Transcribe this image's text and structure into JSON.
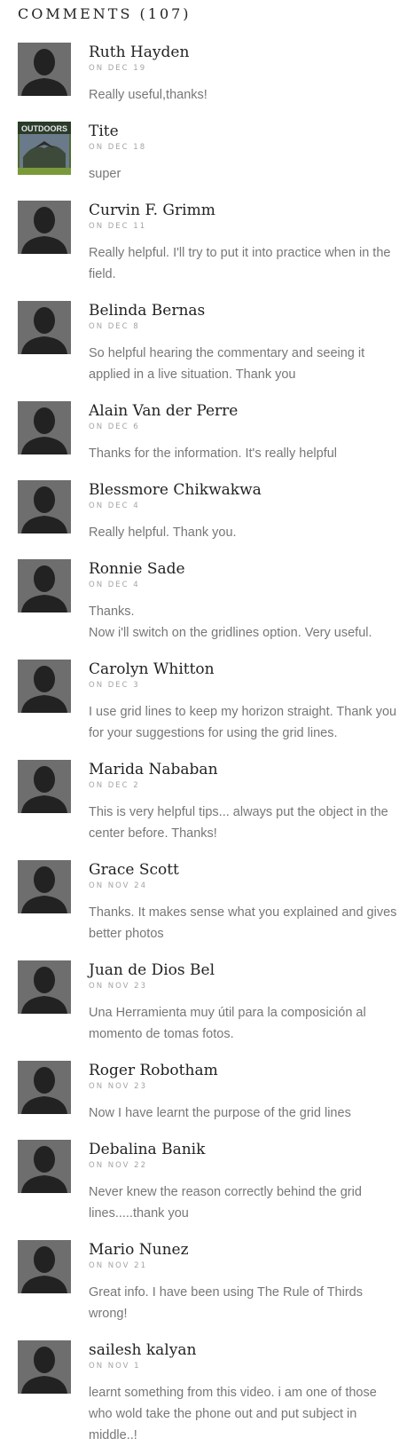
{
  "comments_heading": "COMMENTS (107)",
  "comments": [
    {
      "author": "Ruth Hayden",
      "date": "ON DEC 19",
      "text": "Really useful,thanks!",
      "avatar": "default-avatar"
    },
    {
      "author": "Tite",
      "date": "ON DEC 18",
      "text": "super",
      "avatar": "outdoors-avatar",
      "avatar_text": "OUTDOORS"
    },
    {
      "author": "Curvin F. Grimm",
      "date": "ON DEC 11",
      "text": "Really helpful. I'll try to put it into practice when in the field.",
      "avatar": "default-avatar"
    },
    {
      "author": "Belinda Bernas",
      "date": "ON DEC 8",
      "text": "So helpful hearing the commentary and seeing it applied in a live situation. Thank you",
      "avatar": "default-avatar"
    },
    {
      "author": "Alain Van der Perre",
      "date": "ON DEC 6",
      "text": "Thanks for the information. It's really helpful",
      "avatar": "default-avatar"
    },
    {
      "author": "Blessmore Chikwakwa",
      "date": "ON DEC 4",
      "text": "Really helpful. Thank you.",
      "avatar": "default-avatar"
    },
    {
      "author": "Ronnie Sade",
      "date": "ON DEC 4",
      "text": "Thanks.\nNow i'll switch on the gridlines option. Very useful.",
      "avatar": "default-avatar"
    },
    {
      "author": "Carolyn Whitton",
      "date": "ON DEC 3",
      "text": "I use grid lines to keep my horizon straight. Thank you for your suggestions for using the grid lines.",
      "avatar": "default-avatar"
    },
    {
      "author": "Marida Nababan",
      "date": "ON DEC 2",
      "text": "This is very helpful tips... always put the object in the center before. Thanks!",
      "avatar": "default-avatar"
    },
    {
      "author": "Grace Scott",
      "date": "ON NOV 24",
      "text": "Thanks. It makes sense what you explained and gives better photos",
      "avatar": "default-avatar"
    },
    {
      "author": "Juan de Dios Bel",
      "date": "ON NOV 23",
      "text": "Una Herramienta muy útil para la composición al momento de tomas fotos.",
      "avatar": "default-avatar"
    },
    {
      "author": "Roger Robotham",
      "date": "ON NOV 23",
      "text": "Now I have learnt the purpose of the grid lines",
      "avatar": "default-avatar"
    },
    {
      "author": "Debalina Banik",
      "date": "ON NOV 22",
      "text": "Never knew the reason correctly behind the grid lines.....thank you",
      "avatar": "default-avatar"
    },
    {
      "author": "Mario Nunez",
      "date": "ON NOV 21",
      "text": "Great info. I have been using The Rule of Thirds wrong!",
      "avatar": "default-avatar"
    },
    {
      "author": "sailesh kalyan",
      "date": "ON NOV 1",
      "text": "learnt something from this video. i am one of those who wold take the phone out and put subject in middle..!",
      "avatar": "default-avatar"
    }
  ]
}
